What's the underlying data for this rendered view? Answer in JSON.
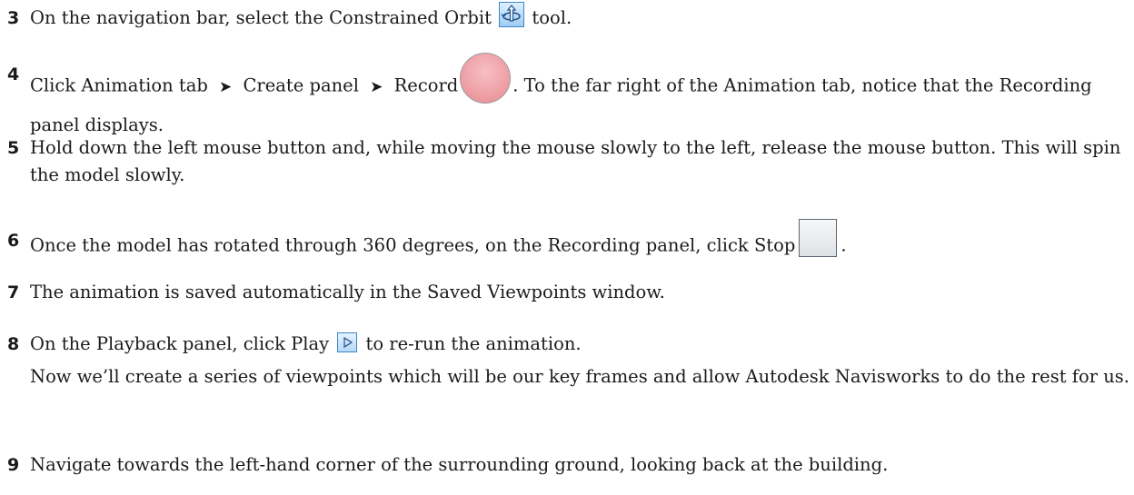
{
  "steps": [
    {
      "number": "3",
      "before": "On the navigation bar, select the Constrained Orbit",
      "icon": "constrained-orbit-icon",
      "after": "tool."
    },
    {
      "number": "4",
      "part1": "Click Animation tab",
      "arrow1": "➤",
      "part2": "Create panel",
      "arrow2": "➤",
      "part3": "Record",
      "icon": "record-icon",
      "after": ". To the far right of the Animation tab, notice that the Recording panel displays."
    },
    {
      "number": "5",
      "text": "Hold down the left mouse button and, while moving the mouse slowly to the left, release the mouse button. This will spin the model slowly."
    },
    {
      "number": "6",
      "before": "Once the model has rotated through 360 degrees, on the Recording panel, click Stop",
      "icon": "stop-icon",
      "after": "."
    },
    {
      "number": "7",
      "text": "The animation is saved automatically in the Saved Viewpoints window."
    },
    {
      "number": "8",
      "before": "On the Playback panel, click Play",
      "icon": "play-icon",
      "after": "to re-run the animation.",
      "note": "Now we’ll create a series of viewpoints which will be our key frames and allow Autodesk Navisworks to do the rest for us."
    },
    {
      "number": "9",
      "text": "Navigate towards the left-hand corner of the surrounding ground, looking back at the building."
    }
  ],
  "colors": {
    "text": "#1a1a1a",
    "icon_blue_border": "#3a86c8",
    "record_fill": "#ec9aa1",
    "stop_border": "#5a6570"
  }
}
